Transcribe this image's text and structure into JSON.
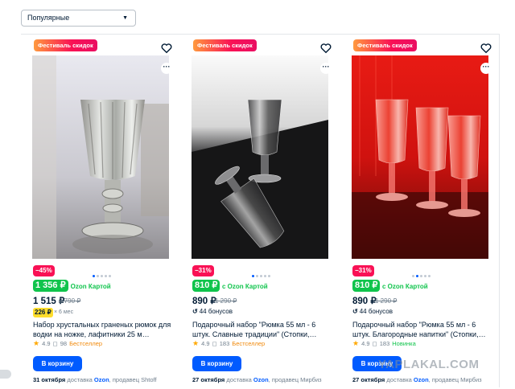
{
  "sort": {
    "selected": "Популярные"
  },
  "watermark": "YAPLAKAL.COM",
  "colors": {
    "accent": "#005bff",
    "green": "#10c44c",
    "sale": "#f91155",
    "installment": "#ffdd2d"
  },
  "cards": [
    {
      "promo": "Фестиваль скидок",
      "discount": "−45%",
      "price_card": "1 356 ₽",
      "price_card_note": "c Ozon Картой",
      "price": "1 515 ₽",
      "old_price": "2 790 ₽",
      "installment": "226 ₽",
      "installment_note": "× 6 мес",
      "title": "Набор хрустальных граненых рюмок для водки на ножке, лафитники 25 м…",
      "rating": "4.9",
      "reviews": "98",
      "badge": "Бестселлер",
      "cart_label": "В корзину",
      "delivery_date": "31 октября",
      "delivery_rest": "доставка",
      "delivery_ozon": "Ozon",
      "seller": ", продавец Shtoff"
    },
    {
      "promo": "Фестиваль скидок",
      "discount": "−31%",
      "price_card": "810 ₽",
      "price_card_note": "c Ozon Картой",
      "price": "890 ₽",
      "old_price": "1 290 ₽",
      "bonus": "44 бонусов",
      "title": "Подарочный набор \"Рюмка 55 мл - 6 штук. Славные традиции\" (Стопки,…",
      "rating": "4.9",
      "reviews": "183",
      "badge": "Бестселлер",
      "cart_label": "В корзину",
      "delivery_date": "27 октября",
      "delivery_rest": "доставка",
      "delivery_ozon": "Ozon",
      "seller": ", продавец Мирбиз"
    },
    {
      "promo": "Фестиваль скидок",
      "discount": "−31%",
      "price_card": "810 ₽",
      "price_card_note": "c Ozon Картой",
      "price": "890 ₽",
      "old_price": "1 290 ₽",
      "bonus": "44 бонусов",
      "title": "Подарочный набор \"Рюмка 55 мл - 6 штук. Благородные напитки\" (Стопки,…",
      "rating": "4.9",
      "reviews": "183",
      "badge": "Новинка",
      "cart_label": "В корзину",
      "delivery_date": "27 октября",
      "delivery_rest": "доставка",
      "delivery_ozon": "Ozon",
      "seller": ", продавец Мирбиз"
    }
  ]
}
